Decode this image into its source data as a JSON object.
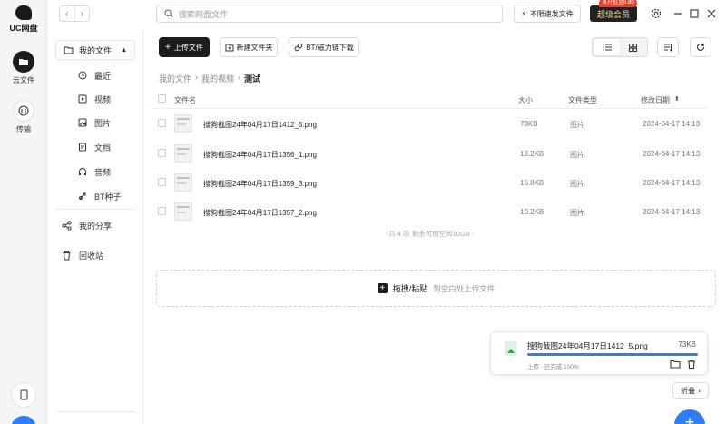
{
  "app": {
    "logo_text": "UC网盘",
    "rail": [
      {
        "id": "cloud",
        "label": "云文件",
        "icon": "folder-icon",
        "active": true
      },
      {
        "id": "transfer",
        "label": "传输",
        "icon": "transfer-icon",
        "active": false
      }
    ]
  },
  "topbar": {
    "search_placeholder": "搜索网盘文件",
    "fast_send_label": "不限速发文件",
    "vip_label": "超级会员",
    "vip_badge": "首开低至8.80"
  },
  "sidebar": {
    "my_files": "我的文件",
    "items": [
      {
        "label": "最近",
        "icon": "clock-icon"
      },
      {
        "label": "视频",
        "icon": "video-icon"
      },
      {
        "label": "图片",
        "icon": "image-icon"
      },
      {
        "label": "文档",
        "icon": "document-icon"
      },
      {
        "label": "音频",
        "icon": "headphones-icon"
      },
      {
        "label": "BT种子",
        "icon": "seed-icon"
      }
    ],
    "share": "我的分享",
    "trash": "回收站"
  },
  "toolbar": {
    "upload": "上传文件",
    "new_folder": "新建文件夹",
    "bt_download": "BT/磁力链下载"
  },
  "breadcrumb": [
    "我的文件",
    "我的视频",
    "测试"
  ],
  "table": {
    "headers": {
      "name": "文件名",
      "size": "大小",
      "type": "文件类型",
      "date": "修改日期"
    },
    "rows": [
      {
        "name": "搜狗截图24年04月17日1412_5.png",
        "size": "73KB",
        "type": "图片",
        "date": "2024-04-17 14:13"
      },
      {
        "name": "搜狗截图24年04月17日1356_1.png",
        "size": "13.2KB",
        "type": "图片",
        "date": "2024-04-17 14:13"
      },
      {
        "name": "搜狗截图24年04月17日1359_3.png",
        "size": "16.8KB",
        "type": "图片",
        "date": "2024-04-17 14:13"
      },
      {
        "name": "搜狗截图24年04月17日1357_2.png",
        "size": "10.2KB",
        "type": "图片",
        "date": "2024-04-17 14:13"
      }
    ],
    "summary": "- 共 4 项 剩余可用空间10GB -"
  },
  "dropzone": {
    "label": "拖拽/粘贴",
    "hint": "到空白处上传文件"
  },
  "upload_card": {
    "file_name": "搜狗截图24年04月17日1412_5.png",
    "file_size": "73KB",
    "status": "上传 · 已完成 100%",
    "progress": 1.0
  },
  "fold_label": "折叠",
  "colors": {
    "accent": "#2e7cf6",
    "dark": "#1c1c1c",
    "vip_badge": "#e6432d"
  }
}
